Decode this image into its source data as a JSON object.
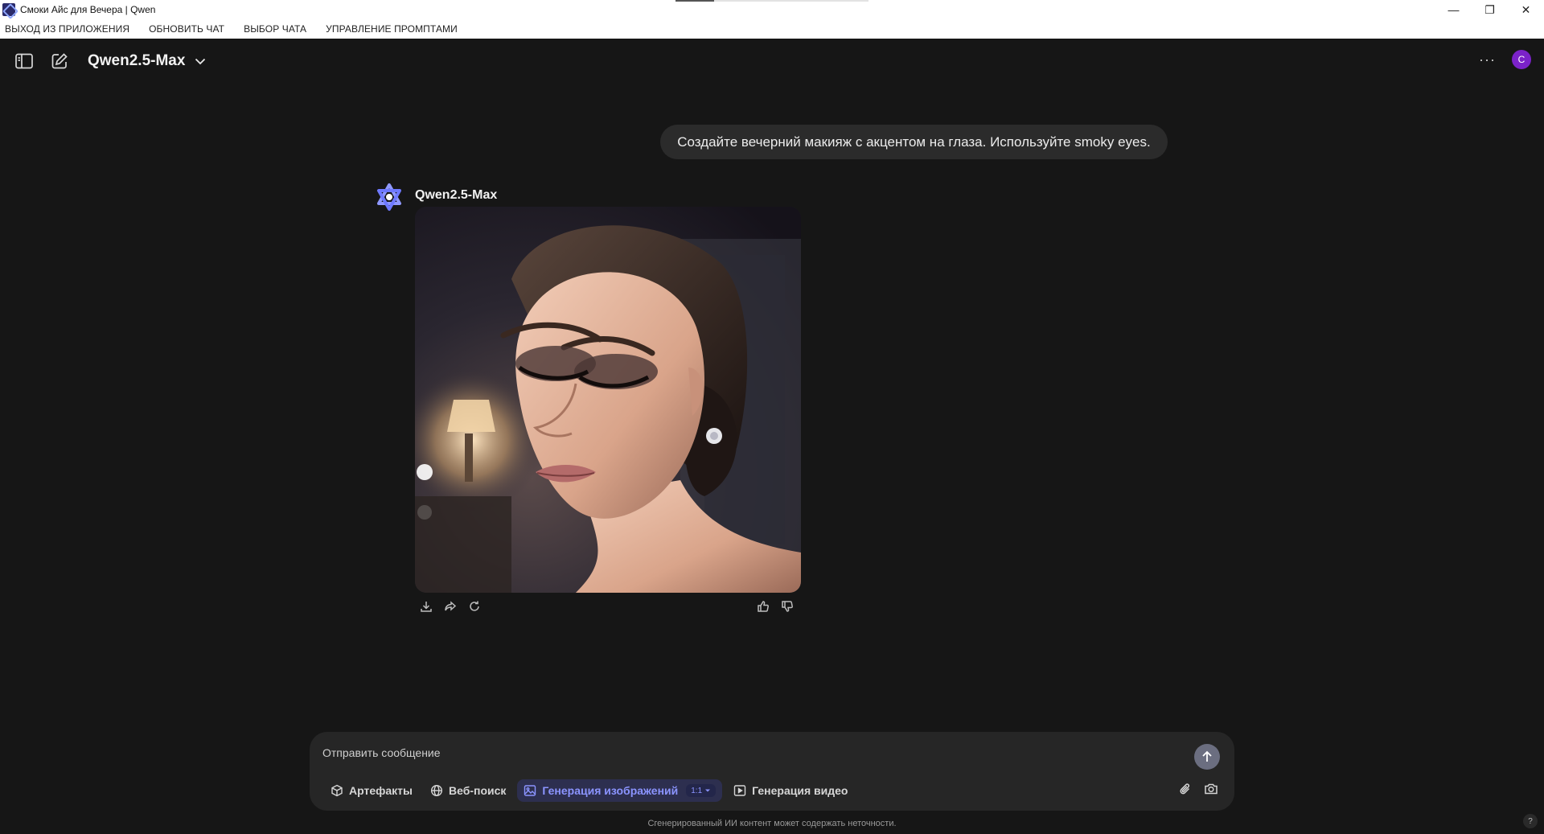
{
  "window": {
    "title": "Смоки Айс для Вечера | Qwen",
    "controls": {
      "minimize": "—",
      "restore": "❐",
      "close": "✕"
    }
  },
  "menu": [
    "ВЫХОД ИЗ ПРИЛОЖЕНИЯ",
    "ОБНОВИТЬ ЧАТ",
    "ВЫБОР ЧАТА",
    "УПРАВЛЕНИЕ ПРОМПТАМИ"
  ],
  "header": {
    "model": "Qwen2.5-Max",
    "more": "···",
    "avatar_initial": "C"
  },
  "chat": {
    "user_message": "Создайте вечерний макияж с акцентом на глаза. Используйте smoky eyes.",
    "assistant_name": "Qwen2.5-Max"
  },
  "composer": {
    "placeholder": "Отправить сообщение",
    "tools": {
      "artifacts": "Артефакты",
      "web_search": "Веб-поиск",
      "image_gen": "Генерация изображений",
      "image_ratio": "1:1",
      "video_gen": "Генерация видео"
    }
  },
  "disclaimer": "Сгенерированный ИИ контент может содержать неточности.",
  "help": "?",
  "colors": {
    "background": "#161616",
    "accent": "#8b94ff",
    "avatar": "#7b22c9"
  }
}
